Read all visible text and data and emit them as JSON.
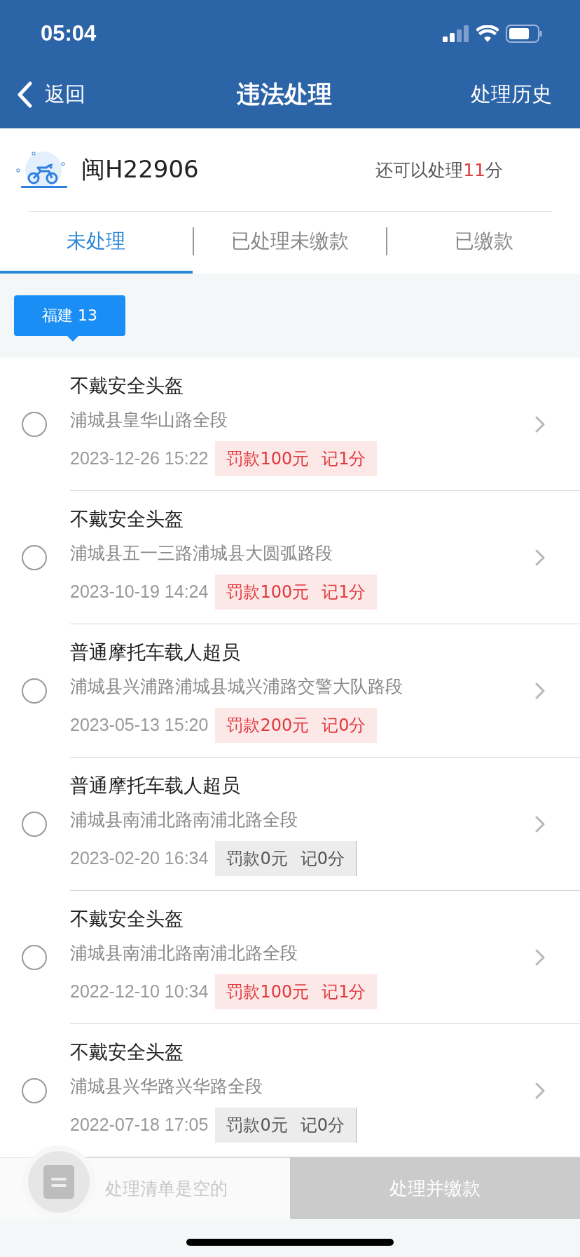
{
  "status_bar": {
    "time": "05:04"
  },
  "nav": {
    "back": "返回",
    "title": "违法处理",
    "action": "处理历史"
  },
  "vehicle": {
    "plate": "闽H22906",
    "quota_prefix": "还可以处理",
    "quota_value": "11",
    "quota_suffix": "分"
  },
  "tabs": [
    {
      "label": "未处理",
      "selected": true
    },
    {
      "label": "已处理未缴款",
      "selected": false
    },
    {
      "label": "已缴款",
      "selected": false
    }
  ],
  "region_tag": "福建 13",
  "violations": [
    {
      "title": "不戴安全头盔",
      "place": "浦城县皇华山路全段",
      "time": "2023-12-26 15:22",
      "fine": "罚款100元",
      "points": "记1分",
      "kind": "alert",
      "checked": false
    },
    {
      "title": "不戴安全头盔",
      "place": "浦城县五一三路浦城县大圆弧路段",
      "time": "2023-10-19 14:24",
      "fine": "罚款100元",
      "points": "记1分",
      "kind": "alert",
      "checked": false
    },
    {
      "title": "普通摩托车载人超员",
      "place": "浦城县兴浦路浦城县城兴浦路交警大队路段",
      "time": "2023-05-13 15:20",
      "fine": "罚款200元",
      "points": "记0分",
      "kind": "alert",
      "checked": false
    },
    {
      "title": "普通摩托车载人超员",
      "place": "浦城县南浦北路南浦北路全段",
      "time": "2023-02-20 16:34",
      "fine": "罚款0元",
      "points": "记0分",
      "kind": "plain",
      "checked": false
    },
    {
      "title": "不戴安全头盔",
      "place": "浦城县南浦北路南浦北路全段",
      "time": "2022-12-10 10:34",
      "fine": "罚款100元",
      "points": "记1分",
      "kind": "alert",
      "checked": false
    },
    {
      "title": "不戴安全头盔",
      "place": "浦城县兴华路兴华路全段",
      "time": "2022-07-18 17:05",
      "fine": "罚款0元",
      "points": "记0分",
      "kind": "plain",
      "checked": false
    }
  ],
  "bottom_bar": {
    "cart_text": "处理清单是空的",
    "submit": "处理并缴款",
    "submit_disabled": true
  }
}
